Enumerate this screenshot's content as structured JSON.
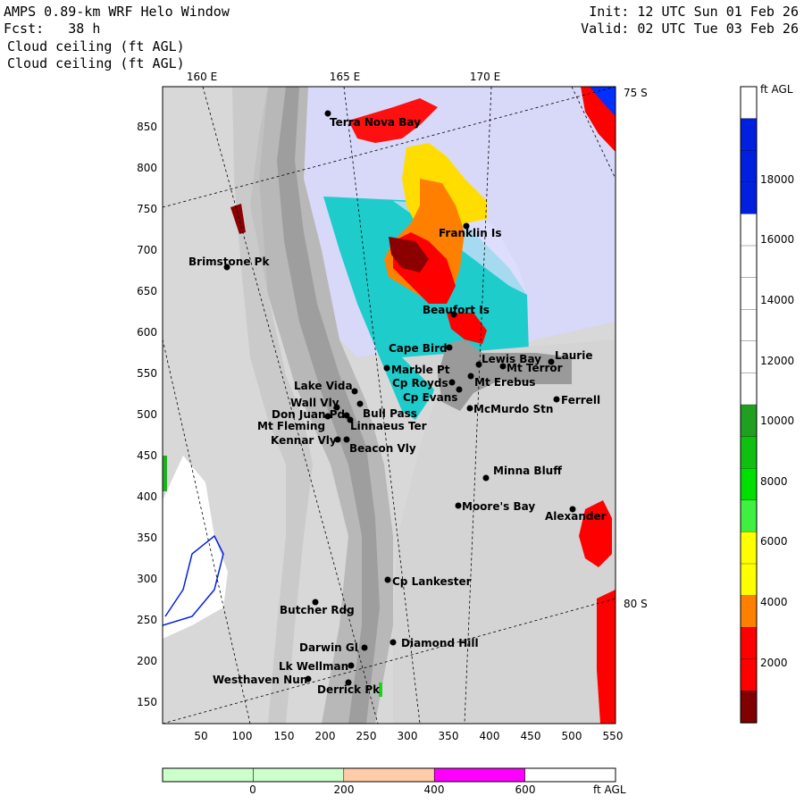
{
  "header": {
    "title": "AMPS 0.89-km WRF Helo Window",
    "fcst": "Fcst:   38 h",
    "field_line1": "Cloud ceiling (ft AGL)",
    "field_line2": "Cloud ceiling (ft AGL)",
    "init": "Init: 12 UTC Sun 01 Feb 26",
    "valid": "Valid: 02 UTC Tue 03 Feb 26"
  },
  "map": {
    "lon_labels": [
      "160 E",
      "165 E",
      "170 E"
    ],
    "lat_labels": [
      "75 S",
      "80 S"
    ],
    "x_ticks": [
      "50",
      "100",
      "150",
      "200",
      "250",
      "300",
      "350",
      "400",
      "450",
      "500",
      "550"
    ],
    "y_ticks": [
      "850",
      "800",
      "750",
      "700",
      "650",
      "600",
      "550",
      "500",
      "450",
      "400",
      "350",
      "300",
      "250",
      "200",
      "150"
    ],
    "places": [
      {
        "name": "Terra Nova Bay"
      },
      {
        "name": "Franklin Is"
      },
      {
        "name": "Brimstone Pk"
      },
      {
        "name": "Beaufort Is"
      },
      {
        "name": "Cape Bird"
      },
      {
        "name": "Lewis Bay"
      },
      {
        "name": "Laurie"
      },
      {
        "name": "Marble Pt"
      },
      {
        "name": "Mt Terror"
      },
      {
        "name": "Cp Royds"
      },
      {
        "name": "Mt Erebus"
      },
      {
        "name": "Lake Vida"
      },
      {
        "name": "Cp Evans"
      },
      {
        "name": "Ferrell"
      },
      {
        "name": "Wall Vly"
      },
      {
        "name": "McMurdo Stn"
      },
      {
        "name": "Bull Pass"
      },
      {
        "name": "Don Juan Pd"
      },
      {
        "name": "Mt Fleming"
      },
      {
        "name": "Linnaeus Ter"
      },
      {
        "name": "Kennar Vly"
      },
      {
        "name": "Beacon Vly"
      },
      {
        "name": "Minna Bluff"
      },
      {
        "name": "Moore's Bay"
      },
      {
        "name": "Alexander"
      },
      {
        "name": "Cp Lankester"
      },
      {
        "name": "Butcher Rdg"
      },
      {
        "name": "Darwin Gl"
      },
      {
        "name": "Diamond Hill"
      },
      {
        "name": "Lk Wellman"
      },
      {
        "name": "Westhaven Nun"
      },
      {
        "name": "Derrick Pk"
      }
    ]
  },
  "colorbar_right": {
    "unit": "ft AGL",
    "labels": [
      "18000",
      "16000",
      "14000",
      "12000",
      "10000",
      "8000",
      "6000",
      "4000",
      "2000"
    ],
    "colors": [
      "#ffffff",
      "#0020e0",
      "#0020e0",
      "#0020e0",
      "#ffffff",
      "#ffffff",
      "#ffffff",
      "#ffffff",
      "#ffffff",
      "#ffffff",
      "#20a020",
      "#10c010",
      "#00e000",
      "#40f040",
      "#ffff00",
      "#ffff00",
      "#ff8000",
      "#ff0000",
      "#ff0000",
      "#800000"
    ]
  },
  "colorbar_bottom": {
    "unit": "ft AGL",
    "labels": [
      "0",
      "200",
      "400",
      "600"
    ],
    "colors": [
      "#ccffcc",
      "#ccffcc",
      "#ffccaa",
      "#ff00ff",
      "#ffffff"
    ]
  }
}
